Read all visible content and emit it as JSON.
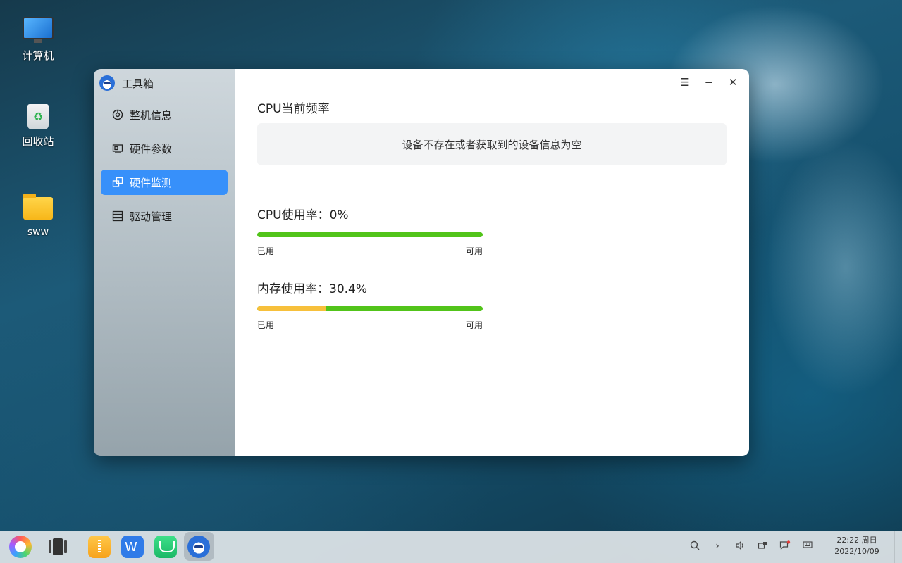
{
  "desktop": {
    "icons": [
      {
        "label": "计算机",
        "icon": "computer-icon"
      },
      {
        "label": "回收站",
        "icon": "trash-icon"
      },
      {
        "label": "sww",
        "icon": "folder-icon"
      }
    ]
  },
  "window": {
    "app_title": "工具箱",
    "nav": [
      {
        "label": "整机信息",
        "icon": "dashboard-icon",
        "active": false
      },
      {
        "label": "硬件参数",
        "icon": "hardware-icon",
        "active": false
      },
      {
        "label": "硬件监测",
        "icon": "monitor-icon",
        "active": true
      },
      {
        "label": "驱动管理",
        "icon": "driver-icon",
        "active": false
      }
    ],
    "controls": {
      "menu": "☰",
      "minimize": "−",
      "close": "✕"
    },
    "cpu_freq": {
      "title": "CPU当前频率",
      "empty_message": "设备不存在或者获取到的设备信息为空"
    },
    "cpu_usage": {
      "title": "CPU使用率：0%",
      "used_fraction": 0.0,
      "used_label": "已用",
      "free_label": "可用"
    },
    "mem_usage": {
      "title": "内存使用率：30.4%",
      "used_fraction": 0.304,
      "used_label": "已用",
      "free_label": "可用"
    },
    "colors": {
      "accent": "#3790fa",
      "used": "#f7c03b",
      "free": "#52c41a"
    }
  },
  "taskbar": {
    "apps": [
      "start-menu-icon",
      "multitask-icon",
      "archive-icon",
      "wps-icon",
      "chat-icon",
      "toolbox-icon"
    ],
    "tray": [
      "search-icon",
      "expand-icon",
      "volume-icon",
      "network-icon",
      "notification-icon",
      "keyboard-icon"
    ],
    "time": "22:22 周日",
    "date": "2022/10/09"
  }
}
